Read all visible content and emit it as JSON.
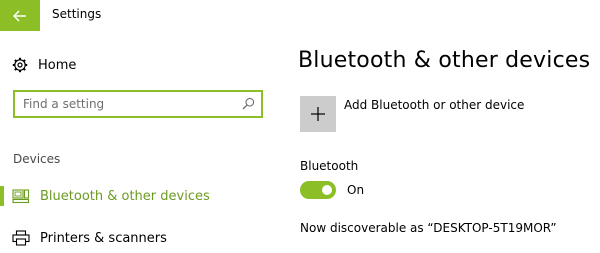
{
  "app": {
    "window_title": "Settings",
    "accent_color": "#8cbf26"
  },
  "sidebar": {
    "home_label": "Home",
    "home_icon": "gear-icon",
    "search": {
      "placeholder": "Find a setting",
      "value": "",
      "icon": "search-icon"
    },
    "section_header": "Devices",
    "items": [
      {
        "label": "Bluetooth & other devices",
        "icon": "bluetooth-devices-icon",
        "selected": true
      },
      {
        "label": "Printers & scanners",
        "icon": "printer-icon",
        "selected": false
      }
    ]
  },
  "main": {
    "title": "Bluetooth & other devices",
    "add_device_label": "Add Bluetooth or other device",
    "add_device_icon": "plus-icon",
    "bluetooth_heading": "Bluetooth",
    "bluetooth_toggle_state": "On",
    "discoverable_text": "Now discoverable as “DESKTOP-5T19MOR”"
  }
}
